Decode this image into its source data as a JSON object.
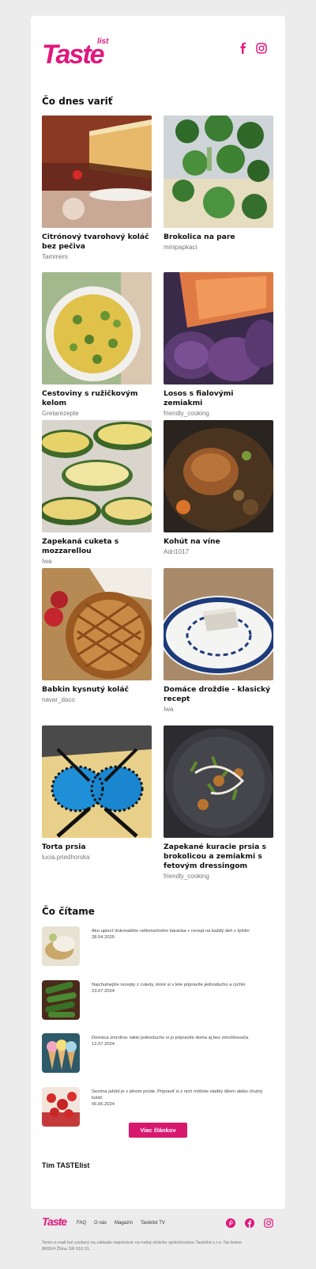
{
  "brand": {
    "logo_main": "Taste",
    "logo_sub": "list",
    "accent": "#e0187e"
  },
  "sections": {
    "recipes_title": "Čo dnes variť",
    "reading_title": "Čo čítame"
  },
  "recipes": [
    {
      "title": "Citrónový tvarohový koláč bez pečiva",
      "author": "Tammers"
    },
    {
      "title": "Brokolica na pare",
      "author": "minipapkaci"
    },
    {
      "title": "Cestoviny s ružičkovým kelom",
      "author": "Gretarezepte"
    },
    {
      "title": "Losos s fialovými zemiakmi",
      "author": "friendly_cooking"
    },
    {
      "title": "Zapekaná cuketa s mozzarellou",
      "author": "Iwa"
    },
    {
      "title": "Kohút na víne",
      "author": "Adri1017"
    },
    {
      "title": "Babkin kysnutý koláč",
      "author": "navar_daco"
    },
    {
      "title": "Domáce droždie - klasický recept",
      "author": "Iwa"
    },
    {
      "title": "Torta prsia",
      "author": "lucia.priedhorska"
    },
    {
      "title": "Zapekané kuracie prsia s brokolicou a zemiakmi s fetovým dressingom",
      "author": "friendly_cooking"
    }
  ],
  "articles": [
    {
      "title": "Ako upiecť dokonalého veľkonočného baránka + recept na každý deň v týždni",
      "date": "28.04.2025"
    },
    {
      "title": "Najchutnejšie recepty z cukety, ktoré si v lete pripravíte jednoducho a rýchlo",
      "date": "23.07.2024"
    },
    {
      "title": "Domáca zmrzlina: takto jednoducho si ju pripravíte doma aj bez zmrzlinovača",
      "date": "12.07.2024"
    },
    {
      "title": "Sezóna jahôd je v plnom prúde. Pripraviť si z nich môžete sladký džem alebo chutný koláč",
      "date": "06.06.2024"
    }
  ],
  "more_button": "Viac článkov",
  "team": "Tím TASTElist",
  "footer": {
    "logo": "Taste",
    "links": [
      "FAQ",
      "O nás",
      "Magazín",
      "Tastelist TV"
    ],
    "fine_print": "Tento e-mail bol zaslaný na základe registrácie na našej stránke spoločnostou Tastelist s.r.o. Na bráne 8665/4 Žilina SR 010 01."
  }
}
